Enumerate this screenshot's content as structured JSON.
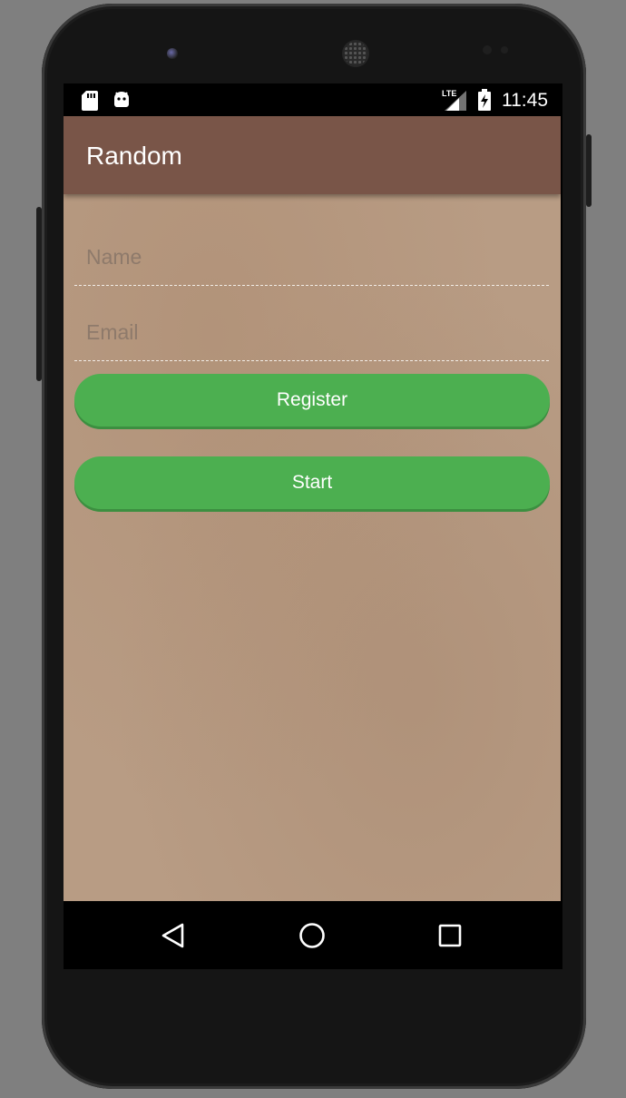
{
  "status_bar": {
    "time": "11:45",
    "network_label": "LTE",
    "icons": [
      "sd-card-icon",
      "android-debug-icon",
      "signal-icon",
      "battery-charging-icon"
    ]
  },
  "app_bar": {
    "title": "Random",
    "color": "#795548"
  },
  "form": {
    "name_placeholder": "Name",
    "name_value": "",
    "email_placeholder": "Email",
    "email_value": ""
  },
  "buttons": {
    "register_label": "Register",
    "start_label": "Start",
    "color": "#4CAF50"
  },
  "nav_bar": {
    "icons": [
      "back-icon",
      "home-icon",
      "recents-icon"
    ]
  }
}
